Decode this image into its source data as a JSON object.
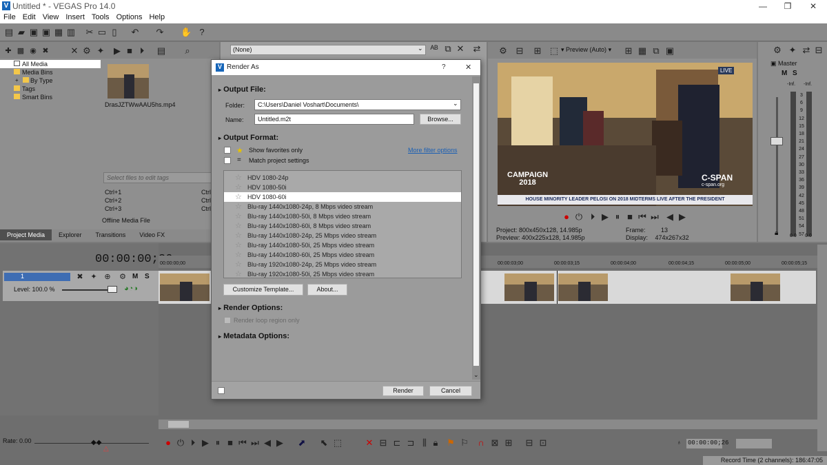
{
  "window": {
    "title": "Untitled * - VEGAS Pro 14.0",
    "min": "—",
    "max": "❐",
    "close": "✕"
  },
  "menu": [
    "File",
    "Edit",
    "View",
    "Insert",
    "Tools",
    "Options",
    "Help"
  ],
  "toolbar_icons": [
    "new-icon",
    "open-icon",
    "save-icon",
    "save-as-icon",
    "properties-icon",
    "trim-icon",
    "undo-icon",
    "redo-icon",
    "tools-icon",
    "help-icon"
  ],
  "media": {
    "tree": [
      "All Media",
      "Media Bins",
      "By Type",
      "Tags",
      "Smart Bins"
    ],
    "file": "DrasJZTWwAAU5hs.mp4",
    "tags_placeholder": "Select files to edit tags",
    "ctrl": [
      "Ctrl+1",
      "Ctrl+2",
      "Ctrl+3"
    ],
    "ctrl2": [
      "Ctrl",
      "Ctrl",
      "Ctrl"
    ],
    "offline": "Offline Media File",
    "tabs": [
      "Project Media",
      "Explorer",
      "Transitions",
      "Video FX"
    ]
  },
  "fx_dropdown": "(None)",
  "preview": {
    "mode": "Preview (Auto)",
    "live_badge": "LIVE",
    "campaign": "CAMPAIGN",
    "year": "2018",
    "cspan": "C-SPAN",
    "cspan_site": "c-span.org",
    "ticker": "HOUSE MINORITY LEADER PELOSI ON 2018 MIDTERMS LIVE AFTER THE PRESIDENT",
    "project_label": "Project:",
    "project_val": "800x450x128, 14.985p",
    "preview_label": "Preview:",
    "preview_val": "400x225x128, 14.985p",
    "frame_label": "Frame:",
    "frame_val": "13",
    "display_label": "Display:",
    "display_val": "474x267x32"
  },
  "master": {
    "label": "Master",
    "m": "M",
    "s": "S",
    "inf": "-Inf.",
    "scale": [
      "3",
      "6",
      "9",
      "12",
      "15",
      "18",
      "21",
      "24",
      "27",
      "30",
      "33",
      "36",
      "39",
      "42",
      "45",
      "48",
      "51",
      "54",
      "57"
    ],
    "zero": "0.0"
  },
  "timeline": {
    "timecode": "00:00:00;26",
    "track_num": "1",
    "level": "Level: 100.0 %",
    "m": "M",
    "s": "S",
    "ruler": [
      "00:00:00;00",
      "00:00:03;00",
      "00:00:03;15",
      "00:00:04;00",
      "00:00:04;15",
      "00:00:05;00",
      "00:00:05;15"
    ],
    "rate": "Rate: 0.00",
    "bottom_tc": "00:00:00;26",
    "record_time": "Record Time (2 channels): 186:47:05"
  },
  "dialog": {
    "title": "Render As",
    "help": "?",
    "close": "✕",
    "output_file": "Output File:",
    "folder_label": "Folder:",
    "folder_value": "C:\\Users\\Daniel Voshart\\Documents\\",
    "name_label": "Name:",
    "name_value": "Untitled.m2t",
    "browse": "Browse...",
    "output_format": "Output Format:",
    "show_fav": "Show favorites only",
    "more_filter": "More filter options",
    "match_settings": "Match project settings",
    "formats": [
      "HDV 1080-24p",
      "HDV 1080-50i",
      "HDV 1080-60i",
      "Blu-ray 1440x1080-24p, 8 Mbps video stream",
      "Blu-ray 1440x1080-50i, 8 Mbps video stream",
      "Blu-ray 1440x1080-60i, 8 Mbps video stream",
      "Blu-ray 1440x1080-24p, 25 Mbps video stream",
      "Blu-ray 1440x1080-50i, 25 Mbps video stream",
      "Blu-ray 1440x1080-60i, 25 Mbps video stream",
      "Blu-ray 1920x1080-24p, 25 Mbps video stream",
      "Blu-ray 1920x1080-50i, 25 Mbps video stream"
    ],
    "selected_index": 2,
    "customize": "Customize Template...",
    "about": "About...",
    "render_options": "Render Options:",
    "render_loop": "Render loop region only",
    "metadata": "Metadata Options:",
    "render_btn": "Render",
    "cancel_btn": "Cancel"
  }
}
